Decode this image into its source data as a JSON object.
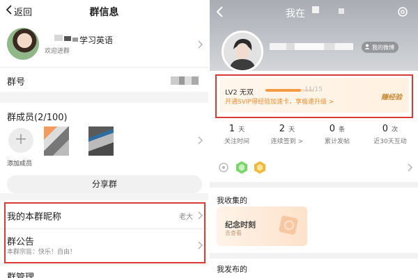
{
  "left": {
    "nav": {
      "back_label": "返回",
      "title": "群信息"
    },
    "group": {
      "name_suffix": "学习英语",
      "subtitle": "欢迎进群"
    },
    "group_no": {
      "label": "群号"
    },
    "members": {
      "title": "群成员(2/100)",
      "add_label": "添加成员"
    },
    "share_label": "分享群",
    "nickname": {
      "label": "我的本群昵称",
      "value": "老大"
    },
    "notice": {
      "label": "群公告",
      "text": "本群宗旨：快乐！自由！"
    },
    "manage": {
      "label": "群管理"
    },
    "highlight_color": "#d93a33"
  },
  "right": {
    "header": {
      "title": "我在"
    },
    "weibo_label": "我的微博",
    "vip": {
      "level": "LV2 无双",
      "progress_text": "11/15",
      "progress_fraction": 0.733,
      "promo": "开通SVIP得经验加速卡，享极速升级 >",
      "badge": "赚经验"
    },
    "stats": [
      {
        "num": "1",
        "unit": "天",
        "label": "关注时间"
      },
      {
        "num": "2",
        "unit": "天",
        "label": "连续签到 >"
      },
      {
        "num": "0",
        "unit": "条",
        "label": "累计发帖"
      },
      {
        "num": "0",
        "unit": "次",
        "label": "近30天互动"
      }
    ],
    "badge_icons": [
      "settings-badge-icon",
      "green-badge-icon",
      "gold-badge-icon"
    ],
    "collections": {
      "title": "我收集的",
      "card_title": "纪念时刻",
      "card_sub": "去查看"
    },
    "published": {
      "title": "我发布的"
    },
    "accent_orange": "#ef8b2d"
  }
}
